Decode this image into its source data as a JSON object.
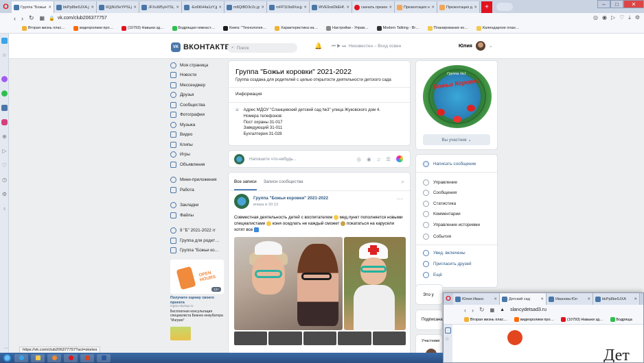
{
  "browser": {
    "tabs": [
      {
        "label": "Группа \"Божьи ко…",
        "active": true
      },
      {
        "label": "bkPp8be5JXA.jpg"
      },
      {
        "label": "6QjNU5eYPSLjp…"
      },
      {
        "label": "JFXuW5yH7SLjpg"
      },
      {
        "label": "-Eo6KH4a1zY.jpg"
      },
      {
        "label": "m8QtBD3c2c.jpg"
      },
      {
        "label": "mFP119s8Xw.jpg"
      },
      {
        "label": "WVE9od2kEHf.jpg"
      },
      {
        "label": "скачать презент…"
      },
      {
        "label": "Презентация на"
      },
      {
        "label": "Презентация для"
      }
    ],
    "address": "vk.com/club206377757",
    "bookmarks": [
      "Вторая жизнь плас…",
      "видеоролики про…",
      "(10793) Навыки зд…",
      "Бодрящая гимнаст…",
      "Книга: \"Технология…",
      "Характеристика на…",
      "Настройки - Управ…",
      "Modern Talking - Br…",
      "Планирование ко…",
      "Календарное план…"
    ],
    "status_url": "https://vk.com/club206377757?act=stories"
  },
  "vk": {
    "logo_text": "ВКОНТАКТЕ",
    "logo_badge": "VK",
    "search_placeholder": "Поиск",
    "player_text": "Неизвестен – Вход освен",
    "user_name": "Юлия",
    "menu": [
      {
        "label": "Моя страница",
        "icon": "profile-icon"
      },
      {
        "label": "Новости",
        "icon": "news-icon"
      },
      {
        "label": "Мессенджер",
        "icon": "messenger-icon"
      },
      {
        "label": "Друзья",
        "icon": "friends-icon"
      },
      {
        "label": "Сообщества",
        "icon": "communities-icon"
      },
      {
        "label": "Фотографии",
        "icon": "photos-icon"
      },
      {
        "label": "Музыка",
        "icon": "music-icon"
      },
      {
        "label": "Видео",
        "icon": "video-icon"
      },
      {
        "label": "Клипы",
        "icon": "clips-icon"
      },
      {
        "label": "Игры",
        "icon": "games-icon"
      },
      {
        "label": "Объявления",
        "icon": "ads-icon"
      }
    ],
    "menu2": [
      {
        "label": "Мини-приложения",
        "icon": "apps-icon"
      },
      {
        "label": "Работа",
        "icon": "work-icon"
      }
    ],
    "menu3": [
      {
        "label": "Закладки",
        "icon": "bookmarks-icon"
      },
      {
        "label": "Файлы",
        "icon": "files-icon"
      }
    ],
    "menu4": [
      {
        "label": "9 \"Б\" 2021-2022 гг",
        "icon": "group-icon"
      },
      {
        "label": "Группа для родит…",
        "icon": "group-icon"
      },
      {
        "label": "Группа \"Божьи ко…",
        "icon": "group-icon"
      }
    ],
    "ad": {
      "img_text": "OPEN HOURS",
      "badge": "12+",
      "title": "Получите оценку своего проекта",
      "domain": "ingria-startup.ru",
      "desc": "Бесплатная консультация специалиста Бизнес-инкубатора \"Ингрия\""
    }
  },
  "group": {
    "title": "Группа \"Божьи коровки\" 2021-2022",
    "subtitle": "Группа создана для родителей с целью открытости деятельности детского сада",
    "info_header": "Информация",
    "info_lines": [
      "Адрес МДОУ \"Сланцевский детский сад №3\" улица Жуковского дом 4.",
      "Номера телефонов:",
      "Пост охраны 31-017",
      "Заведующий 31-011",
      "Бухгалтерия 31-028"
    ],
    "post_placeholder": "Напишите что-нибудь...",
    "feed_tabs": [
      "Все записи",
      "Записи сообщества"
    ],
    "post": {
      "author": "Группа \"Божьи коровки\" 2021-2022",
      "time": "вчера в 20:12",
      "text_1": "Совместная деятельность детей с воспитателем",
      "text_2": "мед.пункт пополняется новыми специалистами",
      "text_3": "коня оседлать не каждый сможет",
      "text_4": "покататься на карусели хотят все"
    },
    "cover": {
      "line1": "Группа №1",
      "line2": "Божьи Коровки"
    },
    "member_button": "Вы участник",
    "actions_primary": "Написать сообщение",
    "actions": [
      "Управление",
      "Сообщения",
      "Статистика",
      "Комментарии",
      "Управление историями",
      "События",
      "Увед. включены",
      "Пригласить друзей",
      "Ещё"
    ],
    "side_blocks": [
      "Это у",
      "Подписана",
      "Участники"
    ]
  },
  "window2": {
    "tabs": [
      "Юлия Иванс",
      "Детский сад",
      "Иванова Юл",
      "bkPp8be5JXA"
    ],
    "address": "slancydetsad3.ru",
    "bookmarks": [
      "Вторая жизнь плас…",
      "видеоролики про…",
      "(10793) Навыки зд…",
      "Бодряща"
    ],
    "heading_fragment": "Дет"
  }
}
